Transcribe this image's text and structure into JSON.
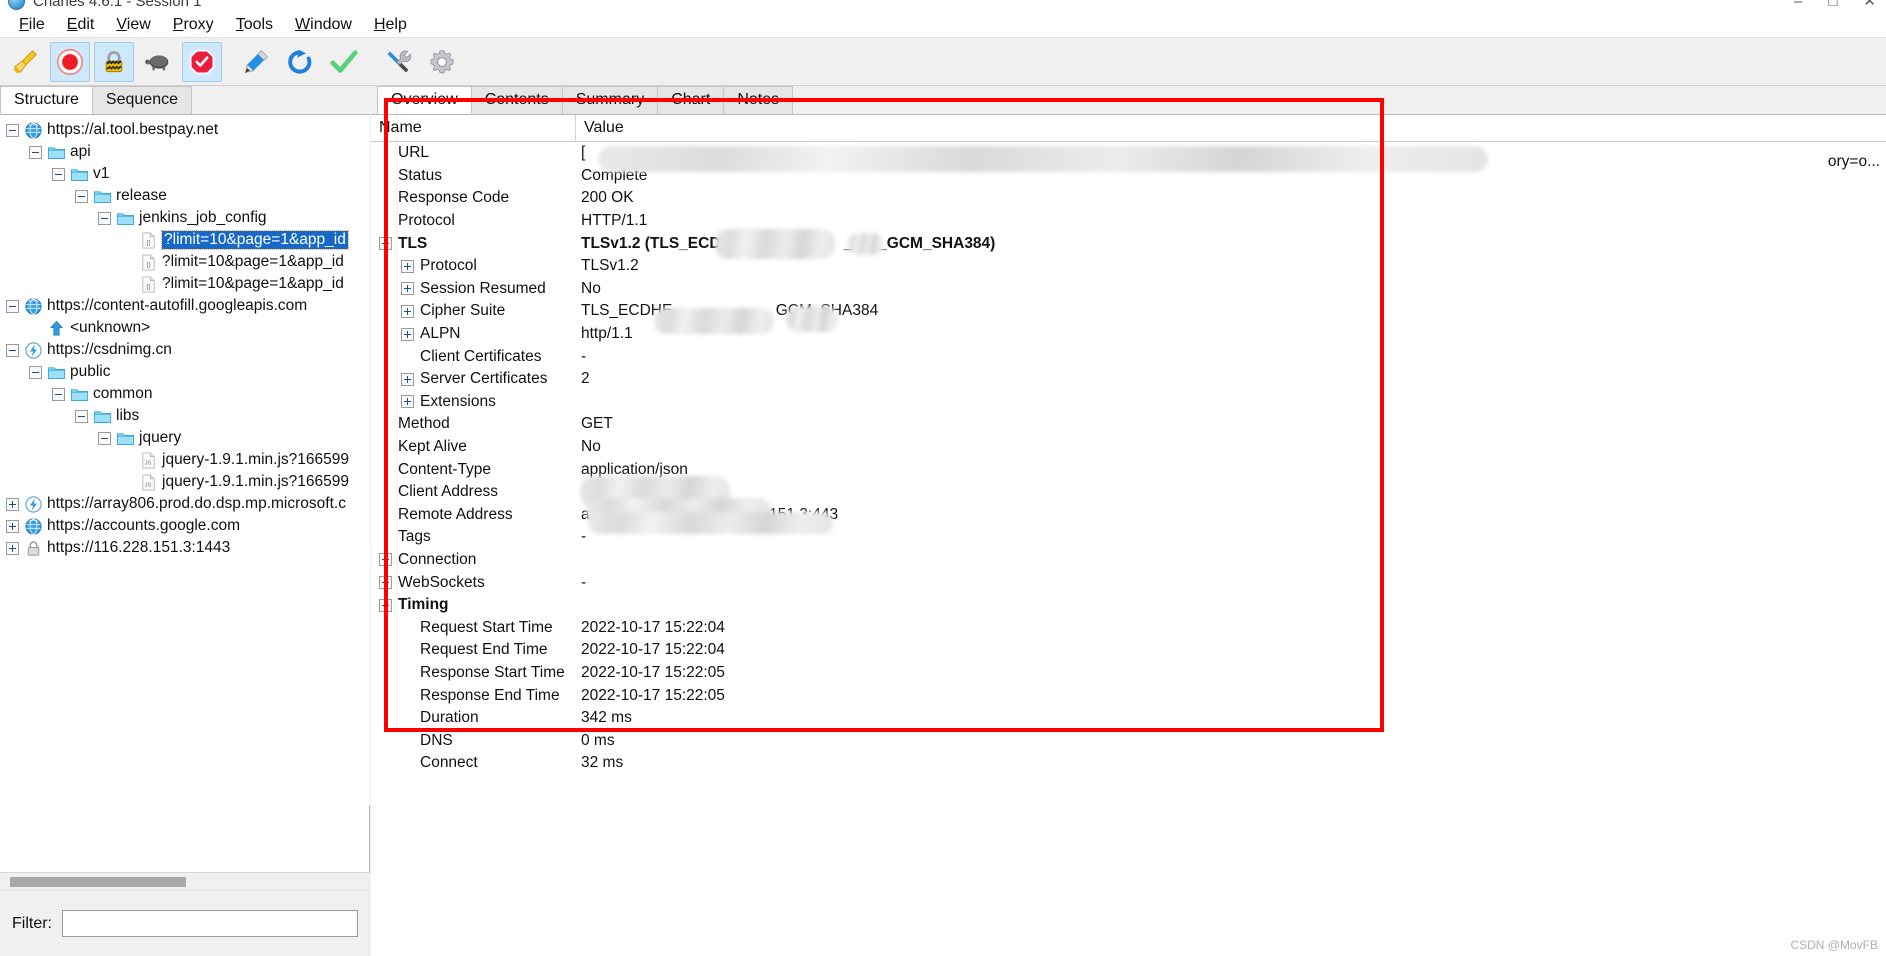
{
  "window": {
    "title": "Charles 4.6.1 - Session 1",
    "app_icon": "charles-globe-icon",
    "minimize": "–",
    "maximize": "□",
    "close": "✕"
  },
  "menubar": {
    "items": [
      {
        "mnemonic": "F",
        "rest": "ile",
        "name": "menu-file"
      },
      {
        "mnemonic": "E",
        "rest": "dit",
        "name": "menu-edit"
      },
      {
        "mnemonic": "V",
        "rest": "iew",
        "name": "menu-view"
      },
      {
        "mnemonic": "P",
        "rest": "roxy",
        "name": "menu-proxy"
      },
      {
        "mnemonic": "T",
        "rest": "ools",
        "name": "menu-tools"
      },
      {
        "mnemonic": "W",
        "rest": "indow",
        "name": "menu-window"
      },
      {
        "mnemonic": "H",
        "rest": "elp",
        "name": "menu-help"
      }
    ]
  },
  "toolbar": {
    "buttons": [
      {
        "icon": "broom-clear-icon",
        "label": "Clear Session",
        "toggled": false
      },
      {
        "icon": "record-icon",
        "label": "Start/Stop Recording",
        "toggled": true
      },
      {
        "icon": "ssl-lock-icon",
        "label": "SSL Proxying",
        "toggled": true
      },
      {
        "icon": "turtle-throttle-icon",
        "label": "Throttle Settings",
        "toggled": false
      },
      {
        "icon": "stop-breakpoint-icon",
        "label": "Breakpoints",
        "toggled": true
      },
      {
        "icon": "compose-pen-icon",
        "label": "Compose",
        "toggled": false
      },
      {
        "icon": "repeat-refresh-icon",
        "label": "Repeat",
        "toggled": false
      },
      {
        "icon": "validate-check-icon",
        "label": "Validate",
        "toggled": false
      },
      {
        "icon": "tools-wrench-icon",
        "label": "Tools",
        "toggled": false
      },
      {
        "icon": "settings-gear-icon",
        "label": "Settings",
        "toggled": false
      }
    ]
  },
  "left_panel": {
    "tabs": [
      {
        "label": "Structure",
        "active": true
      },
      {
        "label": "Sequence",
        "active": false
      }
    ],
    "tree": [
      {
        "depth": 0,
        "toggle": "minus",
        "icon": "globe-icon",
        "label": "https://al.tool.bestpay.net",
        "selected": false
      },
      {
        "depth": 1,
        "toggle": "minus",
        "icon": "folder-icon",
        "label": "api",
        "selected": false
      },
      {
        "depth": 2,
        "toggle": "minus",
        "icon": "folder-icon",
        "label": "v1",
        "selected": false
      },
      {
        "depth": 3,
        "toggle": "minus",
        "icon": "folder-icon",
        "label": "release",
        "selected": false
      },
      {
        "depth": 4,
        "toggle": "minus",
        "icon": "folder-icon",
        "label": "jenkins_job_config",
        "selected": false
      },
      {
        "depth": 5,
        "toggle": "none",
        "icon": "json-file-icon",
        "label": "?limit=10&page=1&app_id",
        "selected": true
      },
      {
        "depth": 5,
        "toggle": "none",
        "icon": "json-file-icon",
        "label": "?limit=10&page=1&app_id",
        "selected": false
      },
      {
        "depth": 5,
        "toggle": "none",
        "icon": "json-file-icon",
        "label": "?limit=10&page=1&app_id",
        "selected": false
      },
      {
        "depth": 0,
        "toggle": "minus",
        "icon": "globe-icon",
        "label": "https://content-autofill.googleapis.com",
        "selected": false
      },
      {
        "depth": 1,
        "toggle": "none",
        "icon": "upload-arrow-icon",
        "label": "<unknown>",
        "selected": false
      },
      {
        "depth": 0,
        "toggle": "minus",
        "icon": "bolt-icon",
        "label": "https://csdnimg.cn",
        "selected": false
      },
      {
        "depth": 1,
        "toggle": "minus",
        "icon": "folder-icon",
        "label": "public",
        "selected": false
      },
      {
        "depth": 2,
        "toggle": "minus",
        "icon": "folder-icon",
        "label": "common",
        "selected": false
      },
      {
        "depth": 3,
        "toggle": "minus",
        "icon": "folder-icon",
        "label": "libs",
        "selected": false
      },
      {
        "depth": 4,
        "toggle": "minus",
        "icon": "folder-icon",
        "label": "jquery",
        "selected": false
      },
      {
        "depth": 5,
        "toggle": "none",
        "icon": "js-file-icon",
        "label": "jquery-1.9.1.min.js?166599",
        "selected": false
      },
      {
        "depth": 5,
        "toggle": "none",
        "icon": "js-file-icon",
        "label": "jquery-1.9.1.min.js?166599",
        "selected": false
      },
      {
        "depth": 0,
        "toggle": "plus",
        "icon": "bolt-icon",
        "label": "https://array806.prod.do.dsp.mp.microsoft.c",
        "selected": false
      },
      {
        "depth": 0,
        "toggle": "plus",
        "icon": "globe-icon",
        "label": "https://accounts.google.com",
        "selected": false
      },
      {
        "depth": 0,
        "toggle": "plus",
        "icon": "padlock-icon",
        "label": "https://116.228.151.3:1443",
        "selected": false
      }
    ],
    "filter": {
      "label": "Filter:",
      "value": "",
      "placeholder": ""
    }
  },
  "right_panel": {
    "tabs": [
      {
        "label": "Overview",
        "active": true
      },
      {
        "label": "Contents",
        "active": false
      },
      {
        "label": "Summary",
        "active": false
      },
      {
        "label": "Chart",
        "active": false
      },
      {
        "label": "Notes",
        "active": false
      }
    ],
    "columns": {
      "name": "Name",
      "value": "Value"
    },
    "rows": [
      {
        "indent": 0,
        "expander": false,
        "bold": false,
        "name": "URL",
        "value": "[",
        "redacted": "full"
      },
      {
        "indent": 0,
        "expander": false,
        "bold": false,
        "name": "Status",
        "value": "Complete"
      },
      {
        "indent": 0,
        "expander": false,
        "bold": false,
        "name": "Response Code",
        "value": "200 OK"
      },
      {
        "indent": 0,
        "expander": false,
        "bold": false,
        "name": "Protocol",
        "value": "HTTP/1.1"
      },
      {
        "indent": 0,
        "expander": true,
        "bold": true,
        "name": "TLS",
        "value": "TLSv1.2 (TLS_ECDH",
        "value_tail": "_256_GCM_SHA384)",
        "redacted": "mid"
      },
      {
        "indent": 1,
        "expander": true,
        "bold": false,
        "name": "Protocol",
        "value": "TLSv1.2"
      },
      {
        "indent": 1,
        "expander": true,
        "bold": false,
        "name": "Session Resumed",
        "value": "No"
      },
      {
        "indent": 1,
        "expander": true,
        "bold": false,
        "name": "Cipher Suite",
        "value": "TLS_ECDHE_",
        "value_tail": "GCM_SHA384",
        "redacted": "mid2"
      },
      {
        "indent": 1,
        "expander": true,
        "bold": false,
        "name": "ALPN",
        "value": "http/1.1"
      },
      {
        "indent": 1,
        "expander": false,
        "bold": false,
        "name": "Client Certificates",
        "value": "-"
      },
      {
        "indent": 1,
        "expander": true,
        "bold": false,
        "name": "Server Certificates",
        "value": "2"
      },
      {
        "indent": 1,
        "expander": true,
        "bold": false,
        "name": "Extensions",
        "value": ""
      },
      {
        "indent": 0,
        "expander": false,
        "bold": false,
        "name": "Method",
        "value": "GET"
      },
      {
        "indent": 0,
        "expander": false,
        "bold": false,
        "name": "Kept Alive",
        "value": "No"
      },
      {
        "indent": 0,
        "expander": false,
        "bold": false,
        "name": "Content-Type",
        "value": "application/json"
      },
      {
        "indent": 0,
        "expander": false,
        "bold": false,
        "name": "Client Address",
        "value": ""
      },
      {
        "indent": 0,
        "expander": false,
        "bold": false,
        "name": "Remote Address",
        "value": "al.tool.bestpay.net/116.228.151.3:443"
      },
      {
        "indent": 0,
        "expander": false,
        "bold": false,
        "name": "Tags",
        "value": "-"
      },
      {
        "indent": 0,
        "expander": true,
        "bold": false,
        "name": "Connection",
        "value": ""
      },
      {
        "indent": 0,
        "expander": true,
        "bold": false,
        "name": "WebSockets",
        "value": "-"
      },
      {
        "indent": 0,
        "expander": true,
        "bold": true,
        "name": "Timing",
        "value": ""
      },
      {
        "indent": 1,
        "expander": false,
        "bold": false,
        "name": "Request Start Time",
        "value": "2022-10-17 15:22:04"
      },
      {
        "indent": 1,
        "expander": false,
        "bold": false,
        "name": "Request End Time",
        "value": "2022-10-17 15:22:04"
      },
      {
        "indent": 1,
        "expander": false,
        "bold": false,
        "name": "Response Start Time",
        "value": "2022-10-17 15:22:05"
      },
      {
        "indent": 1,
        "expander": false,
        "bold": false,
        "name": "Response End Time",
        "value": "2022-10-17 15:22:05"
      },
      {
        "indent": 1,
        "expander": false,
        "bold": false,
        "name": "Duration",
        "value": "342 ms"
      },
      {
        "indent": 1,
        "expander": false,
        "bold": false,
        "name": "DNS",
        "value": "0 ms"
      },
      {
        "indent": 1,
        "expander": false,
        "bold": false,
        "name": "Connect",
        "value": "32 ms"
      }
    ],
    "url_suffix": "ory=o..."
  },
  "annotation": {
    "color": "#ff0000",
    "name": "red-highlight-rectangle"
  },
  "watermark": "CSDN @MovFB"
}
